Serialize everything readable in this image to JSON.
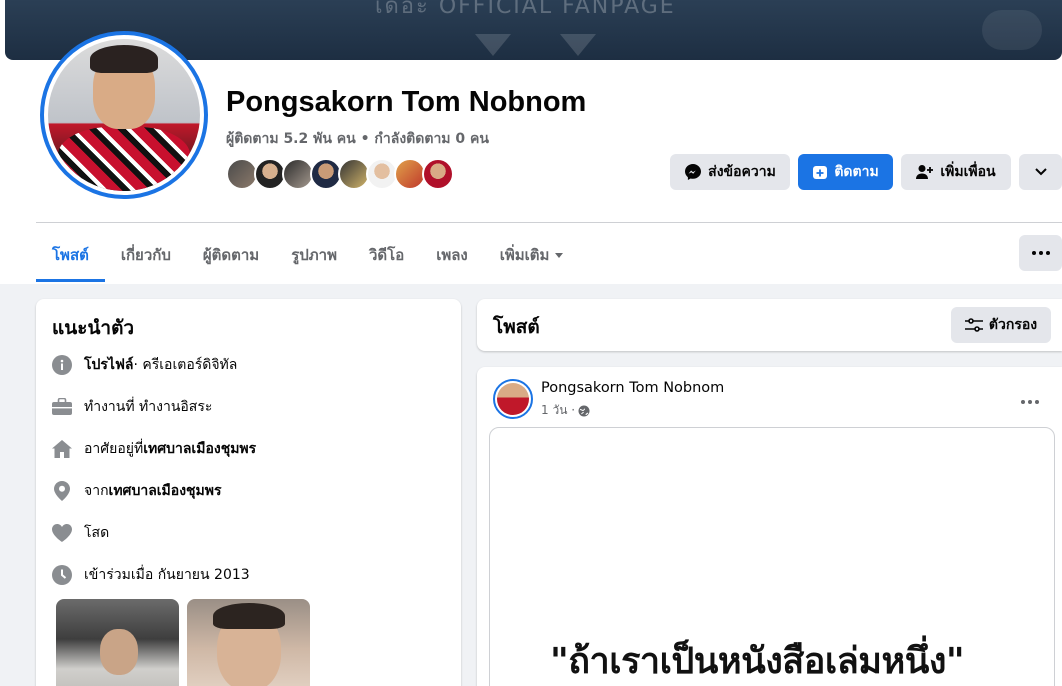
{
  "cover": {
    "text": "เดอะ OFFICIAL FANPAGE"
  },
  "profile": {
    "name": "Pongsakorn Tom Nobnom",
    "stats": "ผู้ติดตาม 5.2 พัน คน • กำลังติดตาม 0 คน"
  },
  "actions": {
    "message_label": "ส่งข้อความ",
    "follow_label": "ติดตาม",
    "add_friend_label": "เพิ่มเพื่อน"
  },
  "tabs": [
    "โพสต์",
    "เกี่ยวกับ",
    "ผู้ติดตาม",
    "รูปภาพ",
    "วิดีโอ",
    "เพลง",
    "เพิ่มเติม"
  ],
  "intro": {
    "title": "แนะนำตัว",
    "rows": [
      {
        "icon": "info-icon",
        "prefix": "",
        "bold": "โปรไฟล์",
        "suffix": " · ครีเอเตอร์ดิจิทัล"
      },
      {
        "icon": "briefcase-icon",
        "prefix": "ทำงานที่ ทำงานอิสระ",
        "bold": "",
        "suffix": ""
      },
      {
        "icon": "home-icon",
        "prefix": "อาศัยอยู่ที่ ",
        "bold": "เทศบาลเมืองชุมพร",
        "suffix": ""
      },
      {
        "icon": "location-pin-icon",
        "prefix": "จาก ",
        "bold": "เทศบาลเมืองชุมพร",
        "suffix": ""
      },
      {
        "icon": "heart-icon",
        "prefix": "โสด",
        "bold": "",
        "suffix": ""
      },
      {
        "icon": "clock-icon",
        "prefix": "เข้าร่วมเมื่อ กันยายน 2013",
        "bold": "",
        "suffix": ""
      }
    ]
  },
  "posts_header": {
    "title": "โพสต์",
    "filter_label": "ตัวกรอง"
  },
  "post": {
    "author": "Pongsakorn Tom Nobnom",
    "time": "1 วัน ·",
    "image_text": "\"ถ้าเราเป็นหนังสือเล่มหนึ่ง\""
  },
  "colors": {
    "accent": "#1b74e4",
    "secondary_text": "#65676b",
    "button_grey": "#e4e6eb"
  }
}
